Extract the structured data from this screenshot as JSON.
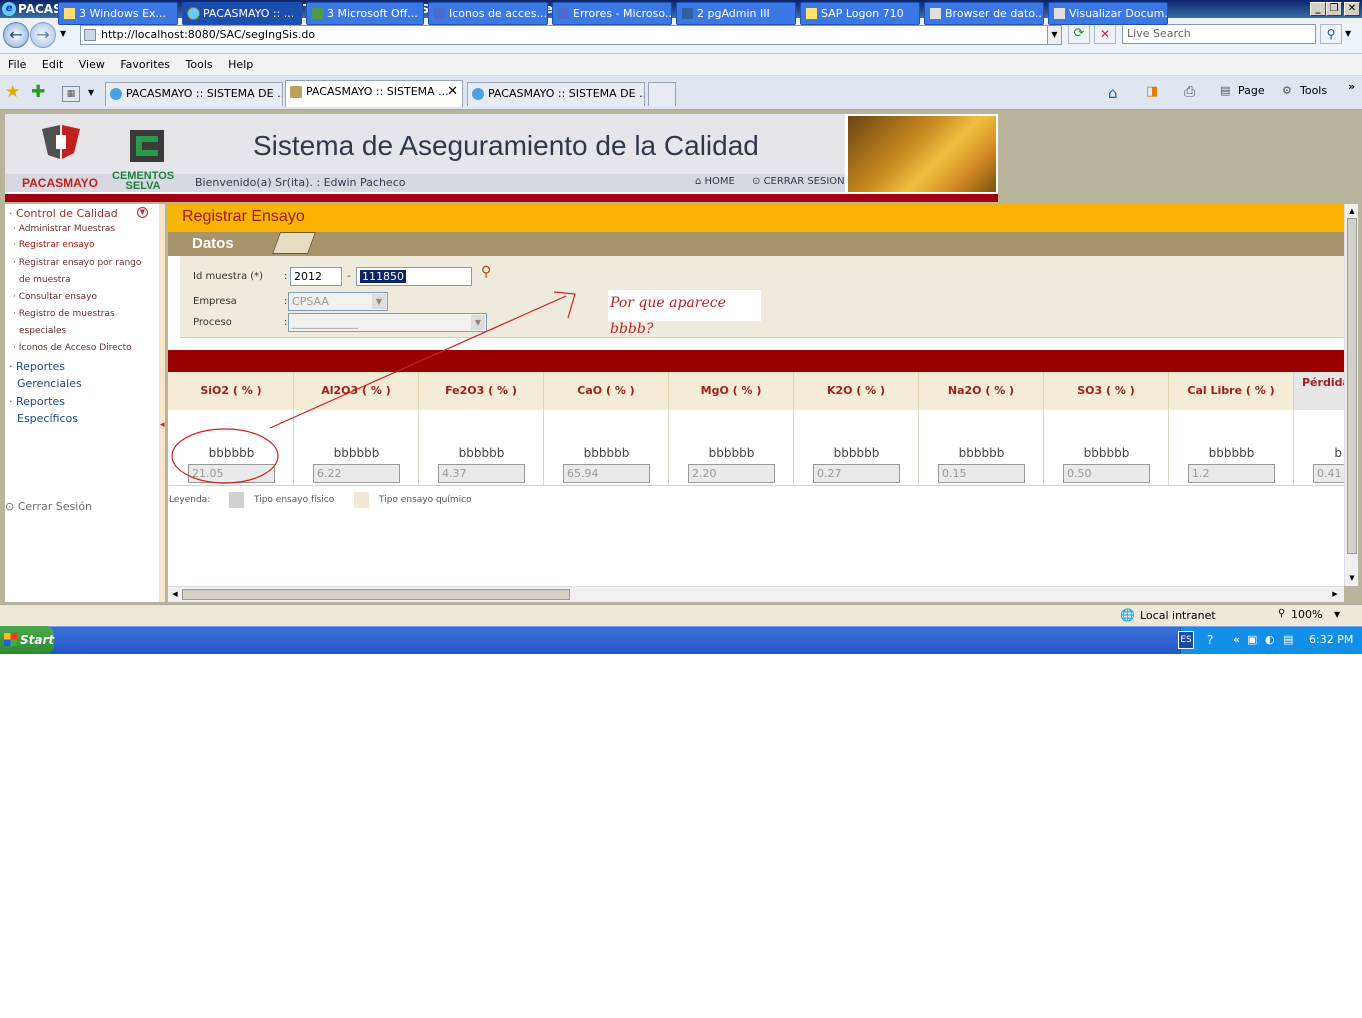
{
  "window": {
    "title": "PACASMAYO :: SISTEMA DE ASEGURAMIENTO DE CALIDAD - SAC - Windows Internet Explorer"
  },
  "browser": {
    "address": "http://localhost:8080/SAC/segIngSis.do",
    "search_placeholder": "Live Search",
    "menu": [
      "File",
      "Edit",
      "View",
      "Favorites",
      "Tools",
      "Help"
    ],
    "tabs": [
      {
        "label": "PACASMAYO :: SISTEMA DE ..."
      },
      {
        "label": "PACASMAYO :: SISTEMA ..."
      },
      {
        "label": "PACASMAYO :: SISTEMA DE ..."
      }
    ],
    "toolbar_right": {
      "page": "Page",
      "tools": "Tools"
    }
  },
  "header": {
    "app_title": "Sistema de Aseguramiento de la Calidad",
    "welcome": "Bienvenido(a) Sr(ita). : Edwin Pacheco",
    "home": "HOME",
    "logout": "CERRAR SESION",
    "logo1": "PACASMAYO",
    "logo2_line1": "CEMENTOS",
    "logo2_line2": "SELVA"
  },
  "sidebar": {
    "section": "Control de Calidad",
    "items": [
      "Administrar Muestras",
      "Registrar ensayo",
      "Registrar ensayo por rango",
      "de muestra",
      "Consultar ensayo",
      "Registro de muestras",
      "especiales",
      "Íconos de Acceso Directo"
    ],
    "reportes_gerenciales": [
      "Reportes",
      "Gerenciales"
    ],
    "reportes_especificos": [
      "Reportes",
      "Específicos"
    ],
    "cerrar": "Cerrar Sesión"
  },
  "main": {
    "title": "Registrar Ensayo",
    "datos": "Datos",
    "form": {
      "id_label": "Id muestra (*)",
      "id_year": "2012",
      "id_sep": "-",
      "id_number": "111850",
      "empresa_label": "Empresa",
      "empresa_value": "CPSAA",
      "proceso_label": "Proceso",
      "proceso_value": "____________",
      "colon": ":"
    },
    "annotation": "Por que aparece bbbb?",
    "columns": [
      {
        "header": "SiO2 ( % )",
        "label": "bbbbbb",
        "value": "21.05"
      },
      {
        "header": "Al2O3 ( % )",
        "label": "bbbbbb",
        "value": "6.22"
      },
      {
        "header": "Fe2O3 ( % )",
        "label": "bbbbbb",
        "value": "4.37"
      },
      {
        "header": "CaO ( % )",
        "label": "bbbbbb",
        "value": "65.94"
      },
      {
        "header": "MgO ( % )",
        "label": "bbbbbb",
        "value": "2.20"
      },
      {
        "header": "K2O ( % )",
        "label": "bbbbbb",
        "value": "0.27"
      },
      {
        "header": "Na2O ( % )",
        "label": "bbbbbb",
        "value": "0.15"
      },
      {
        "header": "SO3 ( % )",
        "label": "bbbbbb",
        "value": "0.50"
      },
      {
        "header": "Cal Libre ( % )",
        "label": "bbbbbb",
        "value": "1.2"
      },
      {
        "header": "Pérdida",
        "label": "b",
        "value": "0.41"
      }
    ],
    "legend": {
      "label": "Leyenda:",
      "fisico": "Tipo ensayo físico",
      "quimico": "Tipo ensayo químico"
    }
  },
  "statusbar": {
    "zone": "Local intranet",
    "zoom": "100%"
  },
  "taskbar": {
    "start": "Start",
    "items": [
      "3 Windows Ex...",
      "PACASMAYO :: ...",
      "3 Microsoft Off...",
      "Iconos de acces...",
      "Errores - Microso...",
      "2 pgAdmin III",
      "SAP Logon 710",
      "Browser de dato...",
      "Visualizar Docum..."
    ],
    "lang": "ES",
    "time": "6:32 PM"
  }
}
